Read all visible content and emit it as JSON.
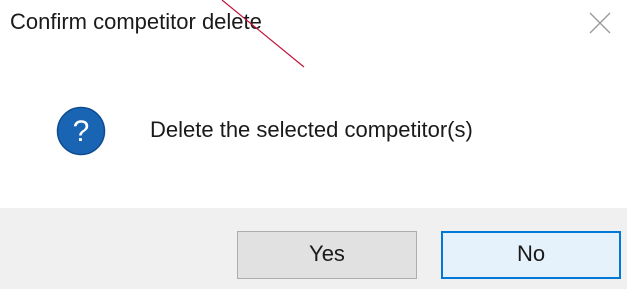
{
  "dialog": {
    "title": "Confirm competitor delete",
    "close_icon": "close-icon",
    "message_icon": "question-icon",
    "message": "Delete the selected competitor(s)",
    "question_mark": "?",
    "buttons": {
      "yes_label": "Yes",
      "no_label": "No"
    }
  },
  "colors": {
    "icon_blue": "#1a64b4",
    "default_button_border": "#0078d7",
    "annotation_line": "#c0143c",
    "footer_background": "#f0f0f0"
  }
}
